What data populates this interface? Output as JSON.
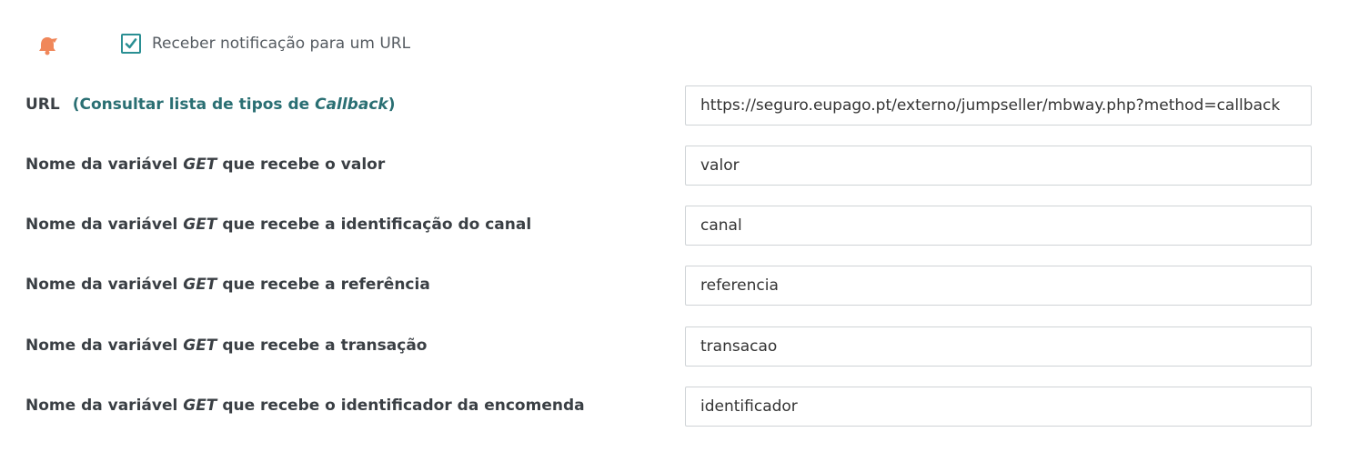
{
  "notification": {
    "icon": "bell-icon",
    "icon_color": "#f0875a",
    "checkbox_checked": true,
    "checkbox_color": "#2a8f93",
    "label": "Receber notificação para um URL"
  },
  "url_field": {
    "label": "URL",
    "link_prefix": "(Consultar lista de tipos de ",
    "link_italic": "Callback",
    "link_suffix": ")",
    "value": "https://seguro.eupago.pt/externo/jumpseller/mbway.php?method=callback"
  },
  "fields": [
    {
      "label_prefix": "Nome da variável ",
      "label_italic": "GET",
      "label_suffix": " que recebe o valor",
      "value": "valor"
    },
    {
      "label_prefix": "Nome da variável ",
      "label_italic": "GET",
      "label_suffix": " que recebe a identificação do canal",
      "value": "canal"
    },
    {
      "label_prefix": "Nome da variável ",
      "label_italic": "GET",
      "label_suffix": " que recebe a referência",
      "value": "referencia"
    },
    {
      "label_prefix": "Nome da variável ",
      "label_italic": "GET",
      "label_suffix": " que recebe a transação",
      "value": "transacao"
    },
    {
      "label_prefix": "Nome da variável ",
      "label_italic": "GET",
      "label_suffix": " que recebe o identificador da encomenda",
      "value": "identificador"
    }
  ]
}
